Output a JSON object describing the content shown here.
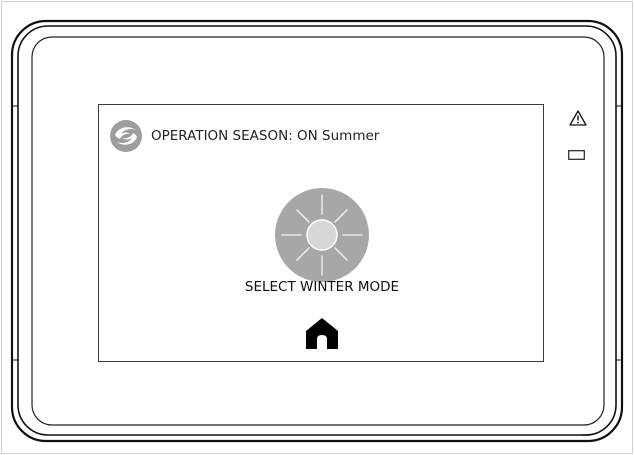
{
  "screen": {
    "header": {
      "logo_icon": "refresh-swirl-logo",
      "season_text": "OPERATION SEASON: ON Summer"
    },
    "sun_button": {
      "icon": "sun-icon",
      "circle_color": "#a7a7a7"
    },
    "mode_label": "SELECT WINTER MODE",
    "home_button": {
      "icon": "home-icon",
      "color": "#000000"
    }
  },
  "device": {
    "warning_icon": "warning-triangle-icon",
    "status_indicator_icon": "status-led-icon"
  }
}
